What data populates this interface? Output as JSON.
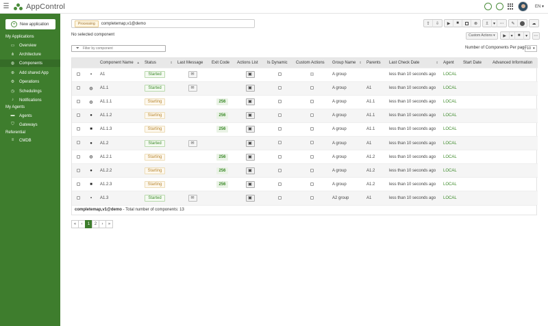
{
  "app": {
    "title": "AppControl",
    "language": "EN"
  },
  "icons": {
    "menu": "hamburger-icon",
    "settings": "gear-icon",
    "help": "help-icon",
    "apps": "grid-icon"
  },
  "colors": {
    "brand": "#3e7d2d",
    "started": "#3c8a2a",
    "starting": "#b8862e",
    "processing": "#a0702a"
  },
  "sidebar": {
    "new_app_label": "New application",
    "sections": [
      {
        "label": "My Applications"
      },
      {
        "label": "My Agents"
      },
      {
        "label": "Referential"
      }
    ],
    "items": [
      {
        "label": "Overview",
        "icon": "monitor-icon"
      },
      {
        "label": "Architecture",
        "icon": "architecture-icon"
      },
      {
        "label": "Components",
        "icon": "components-icon"
      },
      {
        "label": "Add shared App",
        "icon": "add-circle-icon"
      },
      {
        "label": "Operations",
        "icon": "operations-icon"
      },
      {
        "label": "Schedulings",
        "icon": "clock-icon"
      },
      {
        "label": "Notifications",
        "icon": "bell-icon"
      },
      {
        "label": "Agents",
        "icon": "agents-icon"
      },
      {
        "label": "Gateways",
        "icon": "shield-icon"
      },
      {
        "label": "CMDB",
        "icon": "database-icon"
      }
    ]
  },
  "main": {
    "processing_badge": "Processing",
    "application_value": "completemap,v1@demo",
    "no_selected": "No selected component",
    "custom_actions_label": "Custom Actions",
    "filter_placeholder": "Filter by component",
    "per_page_label": "Number of Components Per page",
    "per_page_value": "10",
    "footer_app": "completemap,v1@demo",
    "footer_total": "- Total number of components: 13"
  },
  "table": {
    "headers": [
      "Component Name",
      "Status",
      "Last Message",
      "Exit Code",
      "Actions List",
      "Is Dynamic",
      "Custom Actions",
      "Group Name",
      "Parents",
      "Last Check Date",
      "Agent",
      "Start Date",
      "Advanced Information"
    ],
    "rows": [
      {
        "type": "file",
        "name": "A1",
        "status": "Started",
        "msg": true,
        "exit": "",
        "group": "A group",
        "parent": "",
        "last_check": "less than 10 seconds ago",
        "agent": "LOCAL"
      },
      {
        "type": "globe",
        "name": "A1.1",
        "status": "Started",
        "msg": true,
        "exit": "",
        "group": "A group",
        "parent": "A1",
        "last_check": "less than 10 seconds ago",
        "agent": "LOCAL"
      },
      {
        "type": "globe",
        "name": "A1.1.1",
        "status": "Starting",
        "msg": false,
        "exit": "256",
        "group": "A group",
        "parent": "A1.1",
        "last_check": "less than 10 seconds ago",
        "agent": "LOCAL"
      },
      {
        "type": "dot",
        "name": "A1.1.2",
        "status": "Starting",
        "msg": false,
        "exit": "256",
        "group": "A group",
        "parent": "A1.1",
        "last_check": "less than 10 seconds ago",
        "agent": "LOCAL"
      },
      {
        "type": "square",
        "name": "A1.1.3",
        "status": "Starting",
        "msg": false,
        "exit": "256",
        "group": "A group",
        "parent": "A1.1",
        "last_check": "less than 10 seconds ago",
        "agent": "LOCAL"
      },
      {
        "type": "dot",
        "name": "A1.2",
        "status": "Started",
        "msg": true,
        "exit": "",
        "group": "A group",
        "parent": "A1",
        "last_check": "less than 10 seconds ago",
        "agent": "LOCAL"
      },
      {
        "type": "globe",
        "name": "A1.2.1",
        "status": "Starting",
        "msg": false,
        "exit": "256",
        "group": "A group",
        "parent": "A1.2",
        "last_check": "less than 10 seconds ago",
        "agent": "LOCAL"
      },
      {
        "type": "dot",
        "name": "A1.2.2",
        "status": "Starting",
        "msg": false,
        "exit": "256",
        "group": "A group",
        "parent": "A1.2",
        "last_check": "less than 10 seconds ago",
        "agent": "LOCAL"
      },
      {
        "type": "square",
        "name": "A1.2.3",
        "status": "Starting",
        "msg": false,
        "exit": "256",
        "group": "A group",
        "parent": "A1.2",
        "last_check": "less than 10 seconds ago",
        "agent": "LOCAL"
      },
      {
        "type": "file",
        "name": "A1.3",
        "status": "Started",
        "msg": true,
        "exit": "",
        "group": "A2 group",
        "parent": "A1",
        "last_check": "less than 10 seconds ago",
        "agent": "LOCAL"
      }
    ]
  },
  "pagination": {
    "first": "«",
    "prev": "‹",
    "pages": [
      "1",
      "2"
    ],
    "next": "›",
    "last": "»",
    "current": "1"
  }
}
